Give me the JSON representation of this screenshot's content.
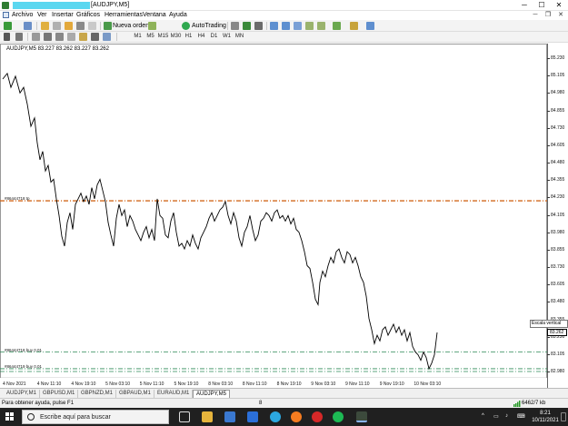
{
  "window": {
    "title": "[AUDJPY,M5]",
    "controls": {
      "minimize": "─",
      "maximize": "☐",
      "close": "✕"
    }
  },
  "menu": {
    "items": [
      "Archivo",
      "Ver",
      "Insertar",
      "Gráficos",
      "Herramientas",
      "Ventana",
      "Ayuda"
    ],
    "mdi_controls": [
      "─",
      "❐",
      "✕"
    ]
  },
  "toolbar": {
    "new_order": "Nueva orden",
    "autotrading": "AutoTrading",
    "timeframes": [
      "M1",
      "M5",
      "M15",
      "M30",
      "H1",
      "H4",
      "D1",
      "W1",
      "MN"
    ]
  },
  "chart": {
    "symbol_label": "AUDJPY,M5  83.227 83.262 83.227 83.262",
    "current_price": "83.262",
    "tooltip": "Escala vertical",
    "y_ticks": [
      "85.230",
      "85.105",
      "84.980",
      "84.855",
      "84.730",
      "84.605",
      "84.480",
      "84.355",
      "84.230",
      "84.105",
      "83.980",
      "83.855",
      "83.730",
      "83.605",
      "83.480",
      "83.355",
      "83.230",
      "83.105",
      "82.980"
    ],
    "x_ticks": [
      "4 Nov 2021",
      "4 Nov 11:10",
      "4 Nov 19:10",
      "5 Nov 03:10",
      "5 Nov 11:10",
      "5 Nov 19:10",
      "8 Nov 03:10",
      "8 Nov 11:10",
      "8 Nov 19:10",
      "9 Nov 03:10",
      "9 Nov 11:10",
      "9 Nov 19:10",
      "10 Nov 03:10"
    ],
    "hlines": [
      {
        "label": "#86444718 tp",
        "price": 84.206,
        "color": "#d2691e"
      },
      {
        "label": "#86444718 buy 0.01",
        "price": 83.12,
        "color": "#2e8b57"
      },
      {
        "label": "#86444719 buy 0.01",
        "price": 83.0,
        "color": "#2e8b57"
      },
      {
        "label": "",
        "price": 82.98,
        "color": "#2e8b57"
      }
    ]
  },
  "tabs": {
    "items": [
      "AUDJPY,M1",
      "GBPUSD,M1",
      "GBPNZD,M1",
      "GBPAUD,M1",
      "EURAUD,M1",
      "AUDJPY,M5"
    ],
    "active_index": 5
  },
  "statusbar": {
    "help_text": "Para obtener ayuda, pulse F1",
    "middle": "8",
    "traffic": "6462/7 kb"
  },
  "taskbar": {
    "search_placeholder": "Escribe aquí para buscar",
    "time": "8:21",
    "date": "10/11/2021"
  }
}
